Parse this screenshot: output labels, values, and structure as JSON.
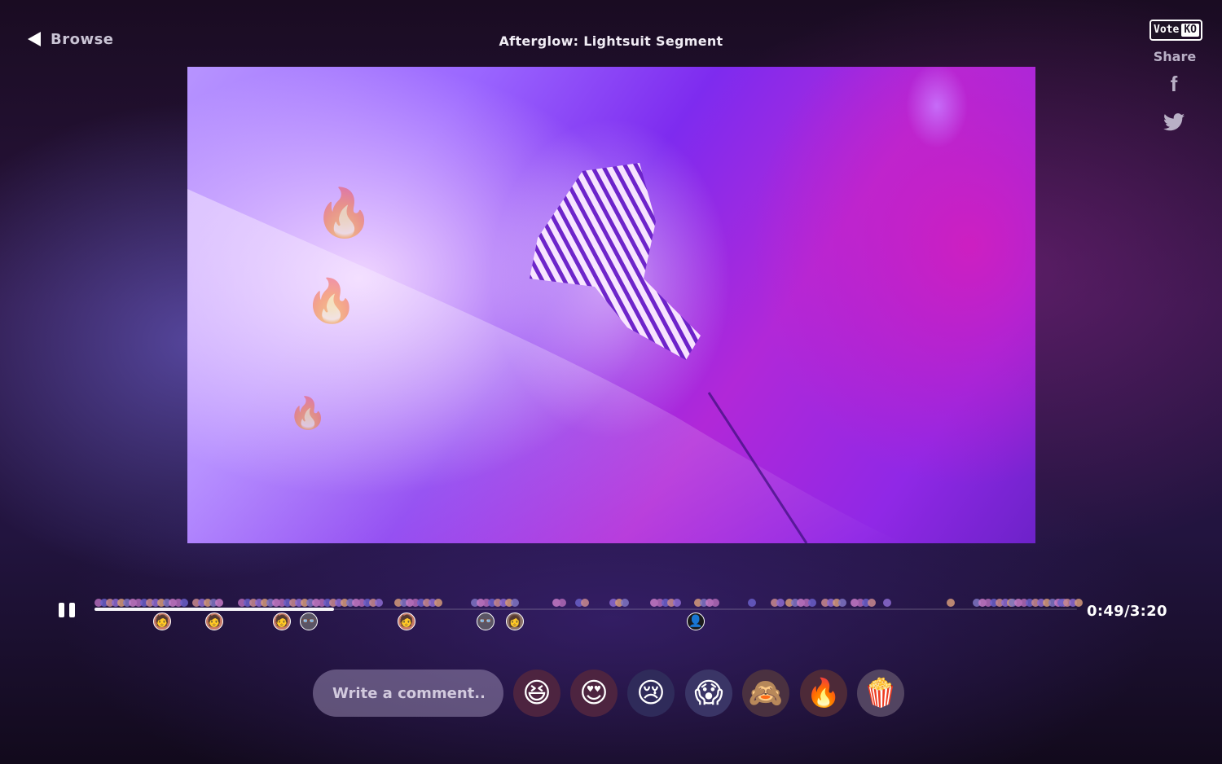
{
  "nav": {
    "back_label": "Browse"
  },
  "video": {
    "title": "Afterglow: Lightsuit Segment"
  },
  "brand": {
    "vote": "Vote",
    "ko": "KO"
  },
  "share": {
    "label": "Share",
    "facebook_glyph": "f",
    "icons": [
      "facebook-icon",
      "twitter-icon"
    ]
  },
  "playback": {
    "current": "0:49",
    "total": "3:20",
    "readout": "0:49/3:20",
    "progress_fraction": 0.245,
    "state": "playing"
  },
  "floating_reactions": [
    "🔥",
    "🔥",
    "🔥"
  ],
  "comment": {
    "placeholder": "Write a comment..."
  },
  "reactions": [
    {
      "name": "laughing",
      "emoji": "😆",
      "bg": "#4d2440"
    },
    {
      "name": "heart-eyes",
      "emoji": "😍",
      "bg": "#4d2440"
    },
    {
      "name": "crying",
      "emoji": "😢",
      "bg": "#2f2b5a"
    },
    {
      "name": "scream",
      "emoji": "😱",
      "bg": "#3a3566"
    },
    {
      "name": "see-no-evil",
      "emoji": "🙈",
      "bg": "#4a3140"
    },
    {
      "name": "fire",
      "emoji": "🔥",
      "bg": "#4d2a38"
    },
    {
      "name": "popcorn",
      "emoji": "🍿",
      "bg": "#524461"
    }
  ],
  "colors": {
    "accent": "#ffffff",
    "track": "#3b2c58",
    "progress": "#f5f3f8"
  }
}
